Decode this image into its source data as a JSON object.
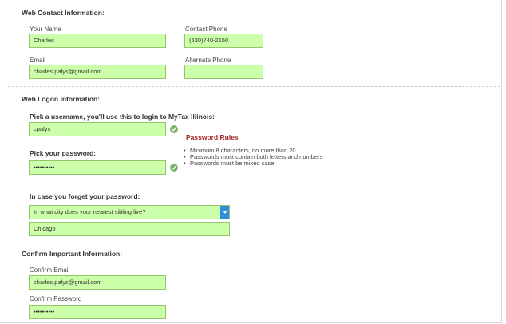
{
  "web_contact": {
    "title": "Web Contact Information:",
    "your_name_label": "Your Name",
    "your_name_value": "Charles",
    "contact_phone_label": "Contact Phone",
    "contact_phone_value": "(630)740-2150",
    "email_label": "Email",
    "email_value": "charles.palys@gmail.com",
    "alternate_phone_label": "Alternate Phone",
    "alternate_phone_value": ""
  },
  "web_logon": {
    "title": "Web Logon Information:",
    "username_label": "Pick a username, you'll use this to login to MyTax Illinois:",
    "username_value": "cpalys",
    "password_label": "Pick your password:",
    "password_value": "••••••••••",
    "rules_title": "Password Rules",
    "rules": [
      "Minimum 8 characters, no more than 20",
      "Passwords must contain both letters and numbers",
      "Passwords must be mixed case"
    ],
    "forget_label": "In case you forget your password:",
    "security_question": "In what city does your nearest sibling live?",
    "security_answer": "Chicago"
  },
  "confirm": {
    "title": "Confirm Important Information:",
    "confirm_email_label": "Confirm Email",
    "confirm_email_value": "charles.palys@gmail.com",
    "confirm_password_label": "Confirm Password",
    "confirm_password_value": "••••••••••"
  },
  "colors": {
    "field_bg": "#ccffaa",
    "field_border": "#95c46a",
    "rules_title": "#a42222",
    "select_arrow": "#2f8ed8",
    "check": "#7db86a"
  },
  "icons": {
    "valid": "check-circle-icon",
    "dropdown": "chevron-down-icon"
  }
}
